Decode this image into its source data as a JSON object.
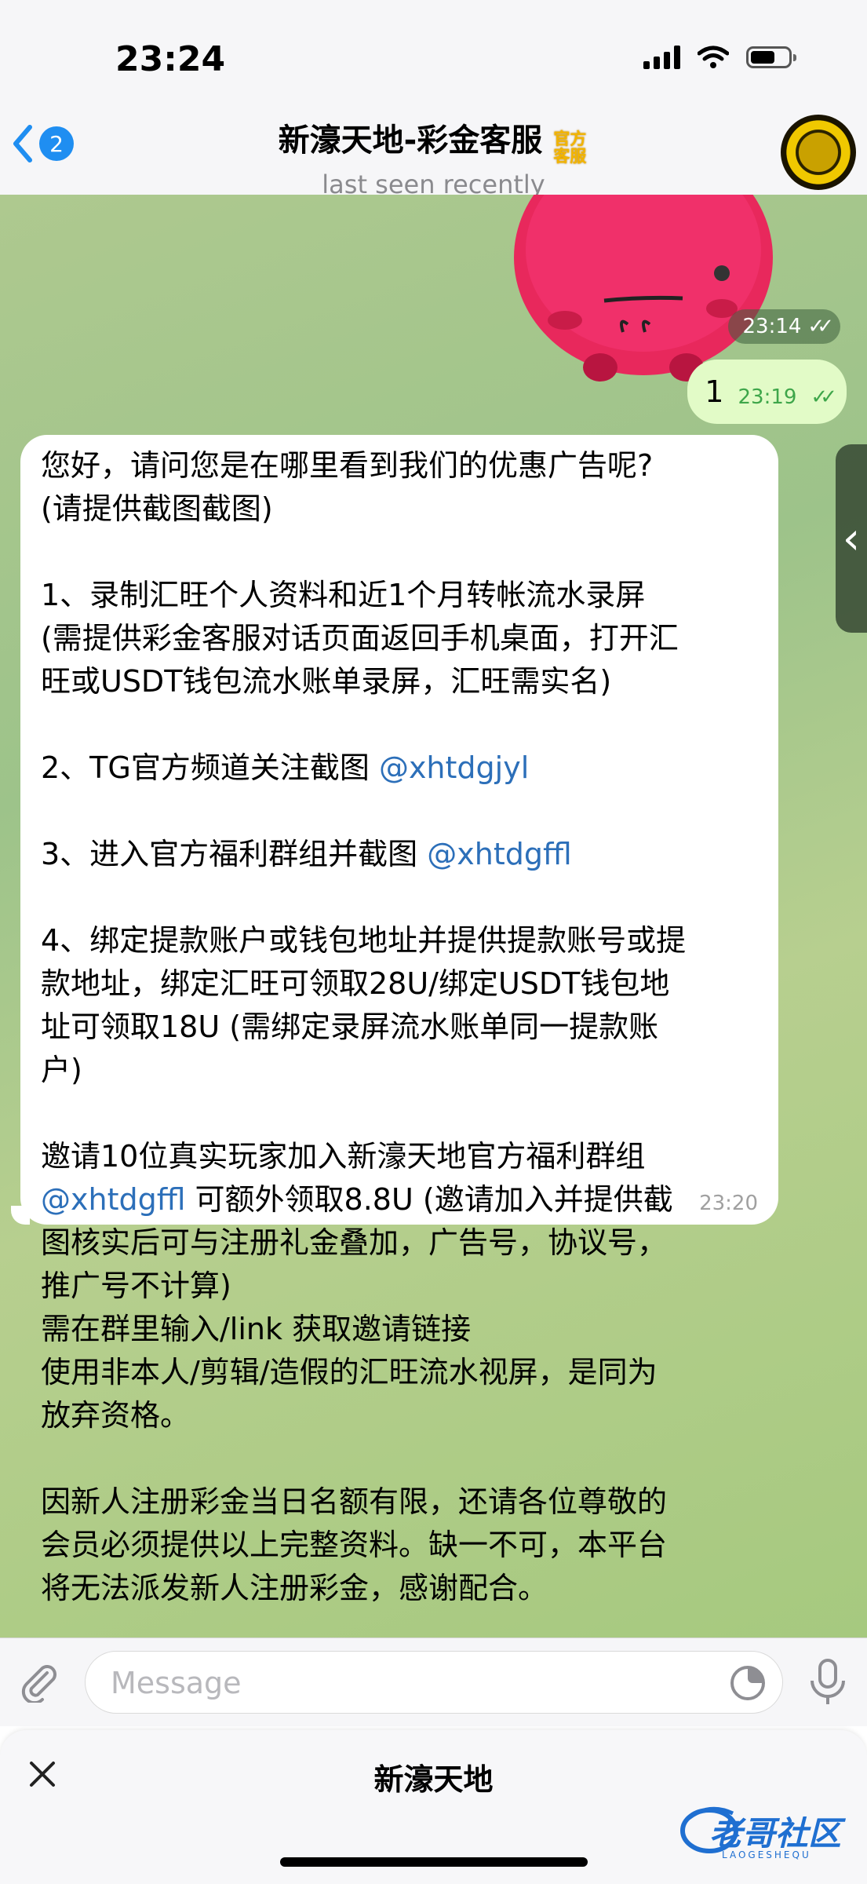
{
  "status_bar": {
    "time": "23:24"
  },
  "header": {
    "back_count": "2",
    "title": "新濠天地-彩金客服",
    "official_badge": "官方客服",
    "subtitle": "last seen recently"
  },
  "chat": {
    "sticker_time": "23:14",
    "outgoing": {
      "text": "1",
      "time": "23:19"
    },
    "incoming": {
      "time": "23:20",
      "lines": [
        "您好，请问您是在哪里看到我们的优惠广告呢?",
        "(请提供截图截图)",
        "",
        "1、录制汇旺个人资料和近1个月转帐流水录屏",
        "(需提供彩金客服对话页面返回手机桌面，打开汇",
        "旺或USDT钱包流水账单录屏，汇旺需实名)",
        "",
        "2、TG官方频道关注截图",
        "",
        "3、进入官方福利群组并截图",
        "",
        "4、绑定提款账户或钱包地址并提供提款账号或提",
        "款地址，绑定汇旺可领取28U/绑定USDT钱包地",
        "址可领取18U (需绑定录屏流水账单同一提款账",
        "户)",
        "",
        "邀请10位真实玩家加入新濠天地官方福利群组",
        "可额外领取8.8U (邀请加入并提供截",
        "图核实后可与注册礼金叠加，广告号，协议号，",
        "推广号不计算)",
        "需在群里输入/link 获取邀请链接",
        "使用非本人/剪辑/造假的汇旺流水视屏，是同为",
        "放弃资格。",
        "",
        "因新人注册彩金当日名额有限，还请各位尊敬的",
        "会员必须提供以上完整资料。缺一不可，本平台",
        "将无法派发新人注册彩金，感谢配合。"
      ],
      "mentions": {
        "channel": "@xhtdgjyl",
        "group": "@xhtdgffl",
        "group2": "@xhtdgffl"
      }
    }
  },
  "input": {
    "placeholder": "Message"
  },
  "bottom_sheet": {
    "title": "新濠天地"
  },
  "watermark": {
    "text": "老哥社区",
    "sub": "LAOGESHEQU"
  },
  "colors": {
    "accent": "#1f8ef1",
    "mention": "#2c6fb9",
    "outgoing_bubble": "#e2fbc7",
    "chat_bg": "#a6c97f"
  },
  "icons": [
    "back-chevron-icon",
    "signal-icon",
    "wifi-icon",
    "battery-icon",
    "attach-icon",
    "sticker-icon",
    "mic-icon",
    "close-icon",
    "read-ticks-icon",
    "side-panel-chevron-icon"
  ]
}
